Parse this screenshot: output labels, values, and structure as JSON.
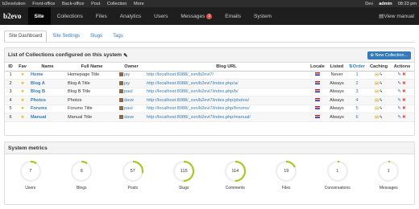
{
  "topbar": {
    "brand": "b2evolution",
    "items": [
      "Front-office",
      "Back-office",
      "Post",
      "Collection",
      "More"
    ],
    "dev": "Dev",
    "user": "admin",
    "time": "08:23 pm"
  },
  "nav": {
    "logo": "b2evo",
    "items": [
      "Site",
      "Collections",
      "Files",
      "Analytics",
      "Users",
      "Messages",
      "Emails",
      "System"
    ],
    "messages_badge": "1",
    "manual": "View manual"
  },
  "tabs": [
    "Site Dashboard",
    "Site Settings",
    "Slugs",
    "Tags"
  ],
  "collections": {
    "title": "List of Collections configured on this system",
    "new_button": "New Collection...",
    "headers": [
      "ID",
      "Fav",
      "Name",
      "Full Name",
      "Owner",
      "Blog URL",
      "Locale",
      "Listed",
      "Order",
      "Caching",
      "Actions"
    ],
    "rows": [
      {
        "id": "1",
        "name": "Home",
        "full": "Homepage Title",
        "owner": "jay",
        "url": "http://localhost:8088/_svn/b2evi7/",
        "listed": "Never",
        "order": "1"
      },
      {
        "id": "2",
        "name": "Blog A",
        "full": "Blog A Title",
        "owner": "jay",
        "url": "http://localhost:8088/_svn/b2evi7/index.php/a/",
        "listed": "Always",
        "order": "2"
      },
      {
        "id": "3",
        "name": "Blog B",
        "full": "Blog B Title",
        "owner": "paul",
        "url": "http://localhost:8088/_svn/b2evi7/index.php/b/",
        "listed": "Always",
        "order": "3"
      },
      {
        "id": "4",
        "name": "Photos",
        "full": "Photos",
        "owner": "dave",
        "url": "http://localhost:8088/_svn/b2evi7/index.php/photos/",
        "listed": "Always",
        "order": "4"
      },
      {
        "id": "5",
        "name": "Forums",
        "full": "Forums Title",
        "owner": "paul",
        "url": "http://localhost:8088/_svn/b2evi7/index.php/forums/",
        "listed": "Always",
        "order": "5"
      },
      {
        "id": "6",
        "name": "Manual",
        "full": "Manual Title",
        "owner": "dave",
        "url": "http://localhost:8088/_svn/b2evi7/index.php/manual/",
        "listed": "Always",
        "order": "6"
      }
    ]
  },
  "metrics": {
    "title": "System metrics",
    "accent": "#a6c92a",
    "items": [
      {
        "label": "Users",
        "value": "7",
        "fill": 0.1
      },
      {
        "label": "Blogs",
        "value": "6",
        "fill": 0.1
      },
      {
        "label": "Posts",
        "value": "57",
        "fill": 0.28
      },
      {
        "label": "Slugs",
        "value": "115",
        "fill": 0.5
      },
      {
        "label": "Comments",
        "value": "114",
        "fill": 0.5
      },
      {
        "label": "Files",
        "value": "19",
        "fill": 0.18
      },
      {
        "label": "Conversations",
        "value": "1",
        "fill": 0.03
      },
      {
        "label": "Messages",
        "value": "1",
        "fill": 0.03
      }
    ]
  }
}
